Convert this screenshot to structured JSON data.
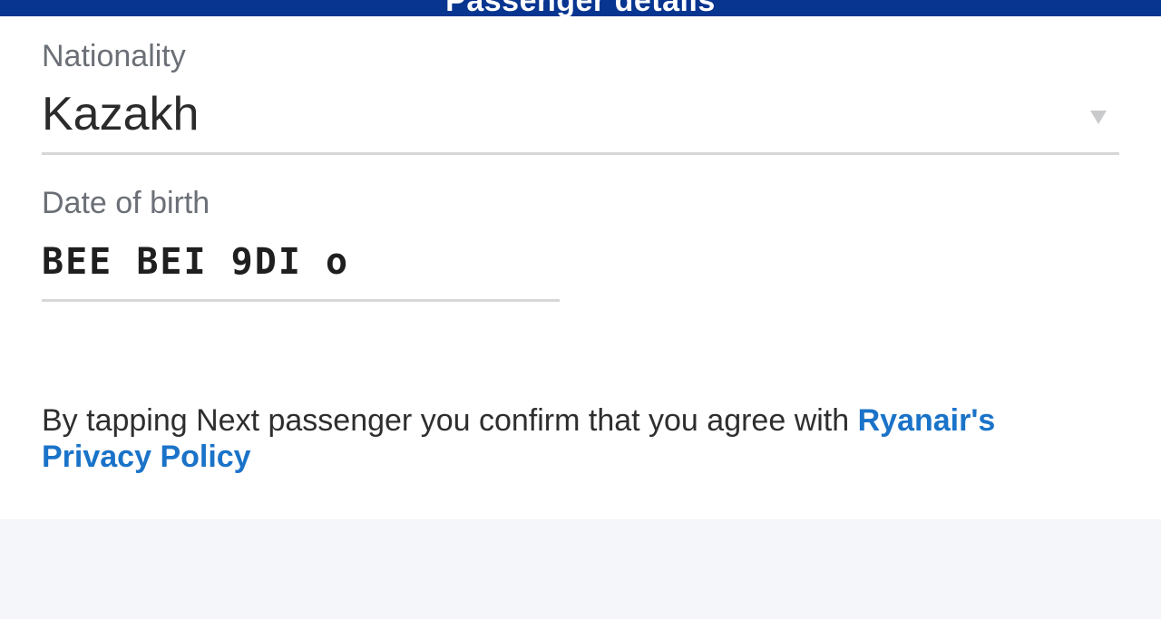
{
  "header": {
    "title": "Passenger details"
  },
  "form": {
    "nationality": {
      "label": "Nationality",
      "value": "Kazakh"
    },
    "date_of_birth": {
      "label": "Date of birth",
      "value": "BEE BEI 9DI o"
    }
  },
  "consent": {
    "text": "By tapping Next passenger you confirm that you agree with ",
    "link_label_line1": "Ryanair's",
    "link_label_line2": "Privacy Policy"
  },
  "colors": {
    "header_bg": "#073590",
    "link": "#1a73c8",
    "footer_bg": "#f4f6fa"
  }
}
